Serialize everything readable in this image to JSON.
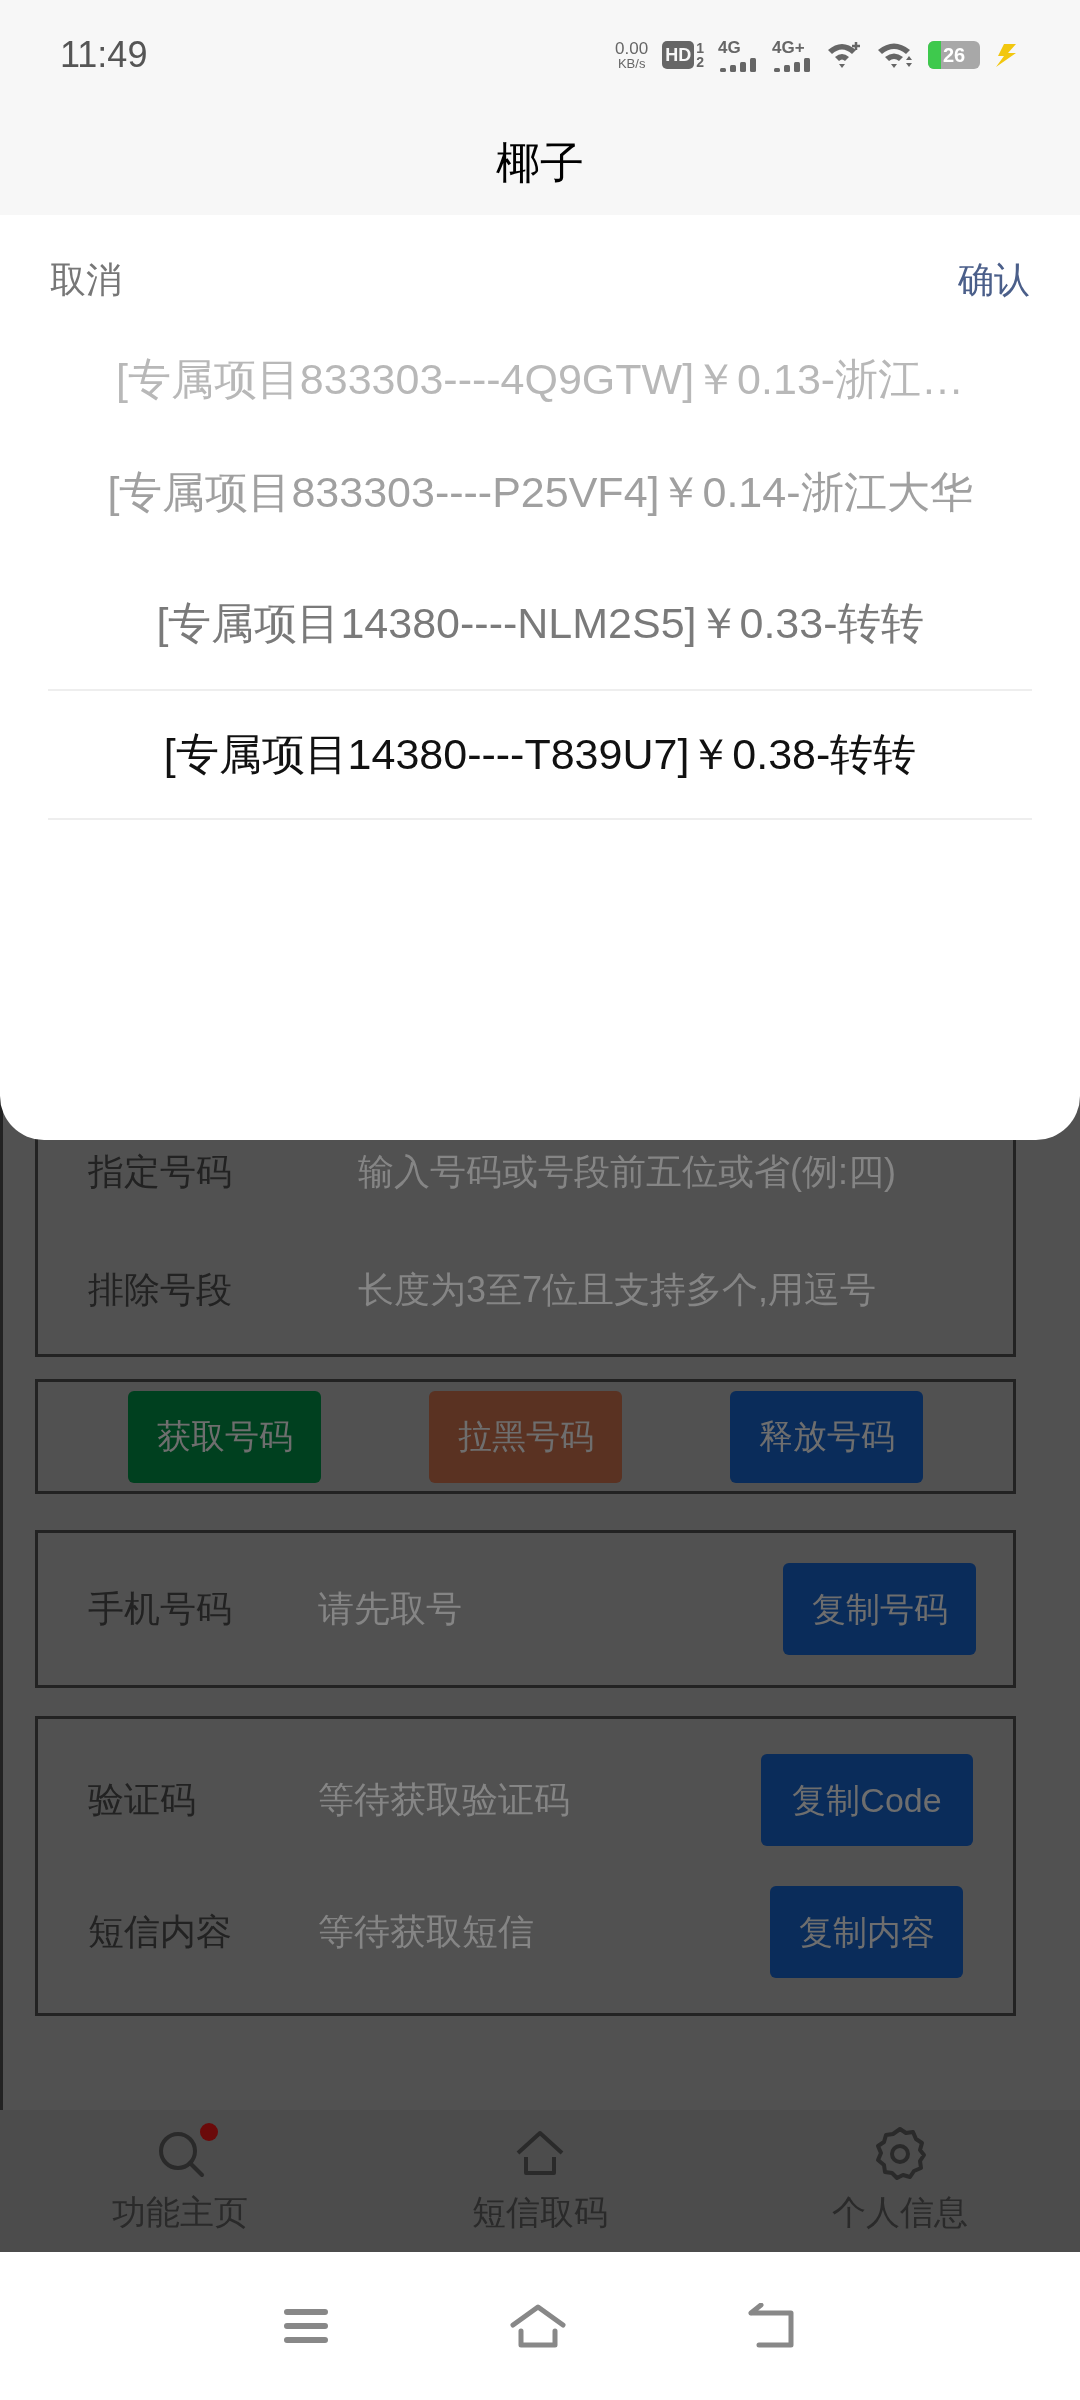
{
  "status_bar": {
    "time": "11:49",
    "net_speed": "0.00",
    "net_unit": "KB/s",
    "hd_label": "HD",
    "hd_slots": [
      "1",
      "2"
    ],
    "signals": [
      "4G",
      "4G+"
    ],
    "battery": "26"
  },
  "header": {
    "title": "椰子"
  },
  "picker": {
    "cancel": "取消",
    "confirm": "确认",
    "options": [
      {
        "label": "[专属项目833303----4Q9GTW]￥0.13-浙江…",
        "selected": false
      },
      {
        "label": "[专属项目833303----P25VF4]￥0.14-浙江大华",
        "selected": false
      },
      {
        "label": "[专属项目14380----NLM2S5]￥0.33-转转",
        "selected": false
      },
      {
        "label": "[专属项目14380----T839U7]￥0.38-转转",
        "selected": true
      }
    ]
  },
  "filters": [
    {
      "label": "指定号码",
      "placeholder": "输入号码或号段前五位或省(例:四)"
    },
    {
      "label": "排除号段",
      "placeholder": "长度为3至7位且支持多个,用逗号"
    }
  ],
  "actions": [
    {
      "label": "获取号码",
      "color": "#00401f"
    },
    {
      "label": "拉黑号码",
      "color": "#5a3222"
    },
    {
      "label": "释放号码",
      "color": "#0a2c5a"
    }
  ],
  "phone": {
    "label": "手机号码",
    "placeholder": "请先取号",
    "button": "复制号码"
  },
  "messages": [
    {
      "label": "验证码",
      "placeholder": "等待获取验证码",
      "button": "复制Code"
    },
    {
      "label": "短信内容",
      "placeholder": "等待获取短信",
      "button": "复制内容"
    }
  ],
  "tab_bar": [
    {
      "label": "功能主页",
      "kind": "search",
      "badge": true
    },
    {
      "label": "短信取码",
      "kind": "home",
      "badge": false
    },
    {
      "label": "个人信息",
      "kind": "settings",
      "badge": false
    }
  ]
}
